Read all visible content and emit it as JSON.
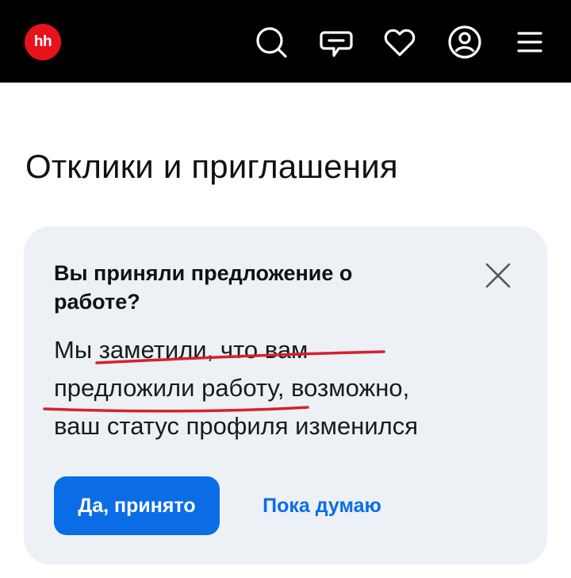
{
  "header": {
    "logo_text": "hh",
    "colors": {
      "bar": "#000000",
      "logo": "#e8121c"
    },
    "icons": [
      "search-icon",
      "chat-icon",
      "heart-icon",
      "profile-icon",
      "menu-icon"
    ]
  },
  "page": {
    "title": "Отклики и приглашения"
  },
  "card": {
    "title": "Вы приняли предложение о работе?",
    "text_line1": "Мы заметили, что вам",
    "text_line2": "предложили работу, возможно,",
    "text_line3": "ваш статус профиля изменился",
    "primary_button": "Да, принято",
    "secondary_button": "Пока думаю",
    "colors": {
      "background": "#edf1f6",
      "accent": "#0a6de6",
      "markup": "#d81f2e"
    }
  }
}
